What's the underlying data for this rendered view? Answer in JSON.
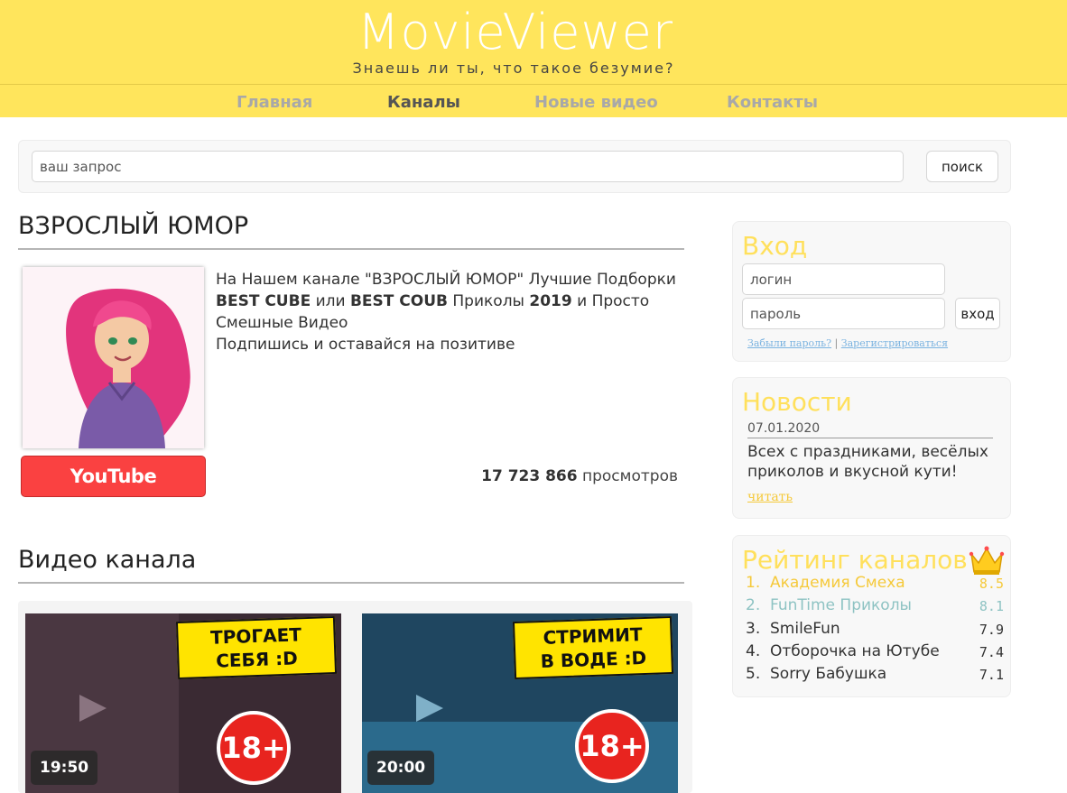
{
  "header": {
    "logo": "MovieViewer",
    "tagline": "Знаешь ли ты, что такое безумие?",
    "nav": [
      {
        "label": "Главная",
        "active": false
      },
      {
        "label": "Каналы",
        "active": true
      },
      {
        "label": "Новые видео",
        "active": false
      },
      {
        "label": "Контакты",
        "active": false
      }
    ]
  },
  "search": {
    "placeholder": "ваш запрос",
    "button_label": "поиск"
  },
  "channel": {
    "title": "ВЗРОСЛЫЙ ЮМОР",
    "description": {
      "line1": "На Нашем канале \"ВЗРОСЛЫЙ ЮМОР\" Лучшие Подборки",
      "l2_b1": "BEST CUBE",
      "l2_t1": " или ",
      "l2_b2": "BEST COUB",
      "l2_t2": " Приколы ",
      "l2_b3": "2019",
      "l2_t3": " и Просто",
      "line3": "Смешные Видео",
      "line4": "Подпишись и оставайся на позитиве"
    },
    "youtube_label": "YouTube",
    "views_count": "17 723 866",
    "views_suffix": "просмотров"
  },
  "videos": {
    "title": "Видео канала",
    "items": [
      {
        "caption_line1": "ТРОГАЕТ",
        "caption_line2": "СЕБЯ :D",
        "badge": "18+",
        "duration": "19:50"
      },
      {
        "caption_line1": "СТРИМИТ",
        "caption_line2": "В ВОДЕ :D",
        "badge": "18+",
        "duration": "20:00"
      }
    ]
  },
  "login": {
    "title": "Вход",
    "login_placeholder": "логин",
    "password_placeholder": "пароль",
    "button_label": "вход",
    "forgot_link": "Забыли пароль?",
    "separator": "|",
    "register_link": "Зарегистрироваться"
  },
  "news": {
    "title": "Новости",
    "date": "07.01.2020",
    "text": "Всех с праздниками, весёлых приколов и вкусной кути!",
    "read_more": "читать"
  },
  "rating": {
    "title": "Рейтинг каналов",
    "icon": "crown-icon",
    "items": [
      {
        "rank": "1.",
        "name": "Академия Смеха",
        "score": "8.5",
        "color": "#f5c93a"
      },
      {
        "rank": "2.",
        "name": "FunTime Приколы",
        "score": "8.1",
        "color": "#8ec3c3"
      },
      {
        "rank": "3.",
        "name": "SmileFun",
        "score": "7.9",
        "color": "#333333"
      },
      {
        "rank": "4.",
        "name": "Отборочка на Ютубе",
        "score": "7.4",
        "color": "#333333"
      },
      {
        "rank": "5.",
        "name": "Sorry Бабушка",
        "score": "7.1",
        "color": "#333333"
      }
    ]
  },
  "colors": {
    "header_bg": "#ffe55c",
    "accent_yellow": "#ffe05c",
    "youtube_red": "#fa4141"
  }
}
